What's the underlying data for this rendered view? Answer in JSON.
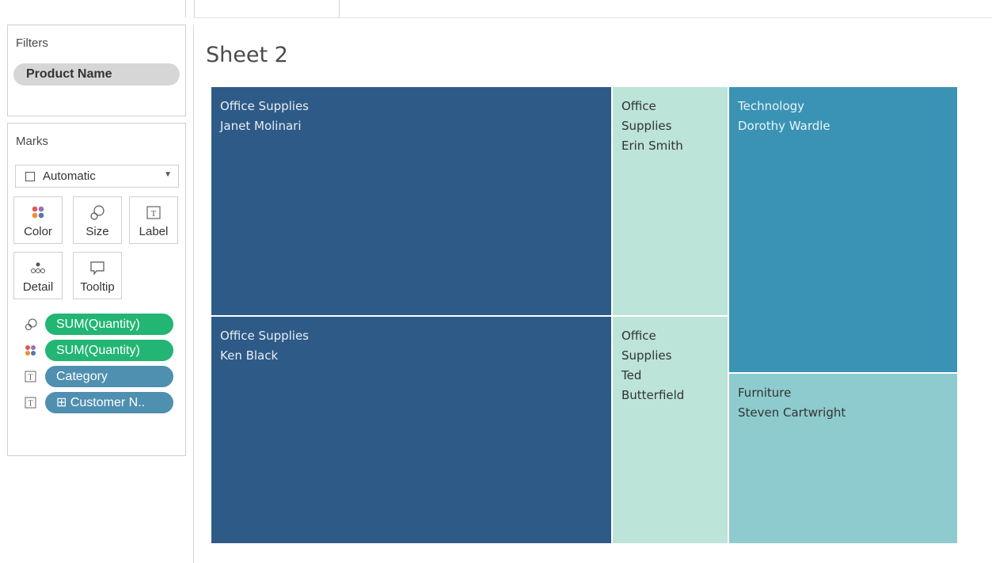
{
  "filters": {
    "title": "Filters",
    "pills": [
      {
        "label": "Product Name"
      }
    ]
  },
  "marks": {
    "title": "Marks",
    "mark_type": "Automatic",
    "buttons": {
      "color": "Color",
      "size": "Size",
      "label": "Label",
      "detail": "Detail",
      "tooltip": "Tooltip"
    },
    "shelf": [
      {
        "icon": "size-icon",
        "label": "SUM(Quantity)",
        "color": "#22b573"
      },
      {
        "icon": "color-icon",
        "label": "SUM(Quantity)",
        "color": "#22b573"
      },
      {
        "icon": "text-label-icon",
        "label": "Category",
        "color": "#4f8fb0"
      },
      {
        "icon": "text-label-icon",
        "label": "⊞ Customer N..",
        "color": "#4f8fb0"
      }
    ]
  },
  "sheet": {
    "title": "Sheet 2"
  },
  "chart_data": {
    "type": "treemap",
    "size_measure": "SUM(Quantity)",
    "color_measure": "SUM(Quantity)",
    "label_fields": [
      "Category",
      "Customer Name"
    ],
    "tiles": [
      {
        "category": "Office Supplies",
        "customer": "Janet Molinari",
        "label": "Office Supplies\nJanet Molinari",
        "color": "#2e5a87",
        "text_color": "#e8eef5"
      },
      {
        "category": "Office Supplies",
        "customer": "Ken Black",
        "label": "Office Supplies\nKen Black",
        "color": "#2e5a87",
        "text_color": "#e8eef5"
      },
      {
        "category": "Office Supplies",
        "customer": "Erin Smith",
        "label": "Office\nSupplies\nErin Smith",
        "color": "#bce4d8",
        "text_color": "#333333"
      },
      {
        "category": "Office Supplies",
        "customer": "Ted Butterfield",
        "label": "Office\nSupplies\nTed\nButterfield",
        "color": "#bce4d8",
        "text_color": "#333333"
      },
      {
        "category": "Technology",
        "customer": "Dorothy Wardle",
        "label": "Technology\nDorothy Wardle",
        "color": "#3a93b4",
        "text_color": "#e8f4f8"
      },
      {
        "category": "Furniture",
        "customer": "Steven Cartwright",
        "label": "Furniture\nSteven Cartwright",
        "color": "#8ecbce",
        "text_color": "#333333"
      }
    ]
  }
}
